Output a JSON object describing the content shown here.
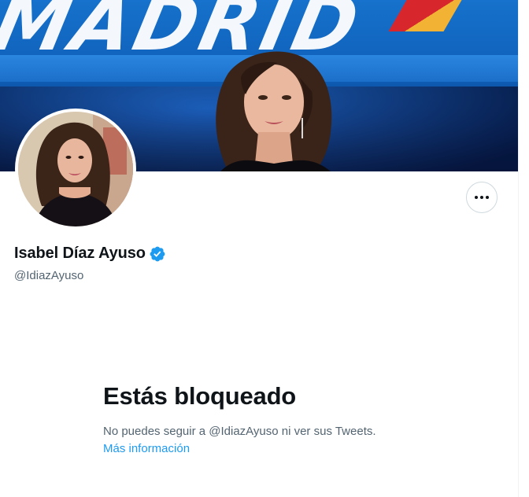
{
  "banner": {
    "text": "MADRID",
    "icon": "banner-photo"
  },
  "profile": {
    "display_name": "Isabel Díaz Ayuso",
    "handle": "@IdiazAyuso",
    "verified_icon": "verified-badge-icon",
    "more_icon": "more-horizontal-icon"
  },
  "blocked": {
    "title": "Estás bloqueado",
    "description": "No puedes seguir a @IdiazAyuso ni ver sus Tweets.",
    "link": "Más información"
  },
  "colors": {
    "accent": "#1d9bf0",
    "text_primary": "#0f1419",
    "text_secondary": "#536471",
    "border": "#cfd9de"
  }
}
